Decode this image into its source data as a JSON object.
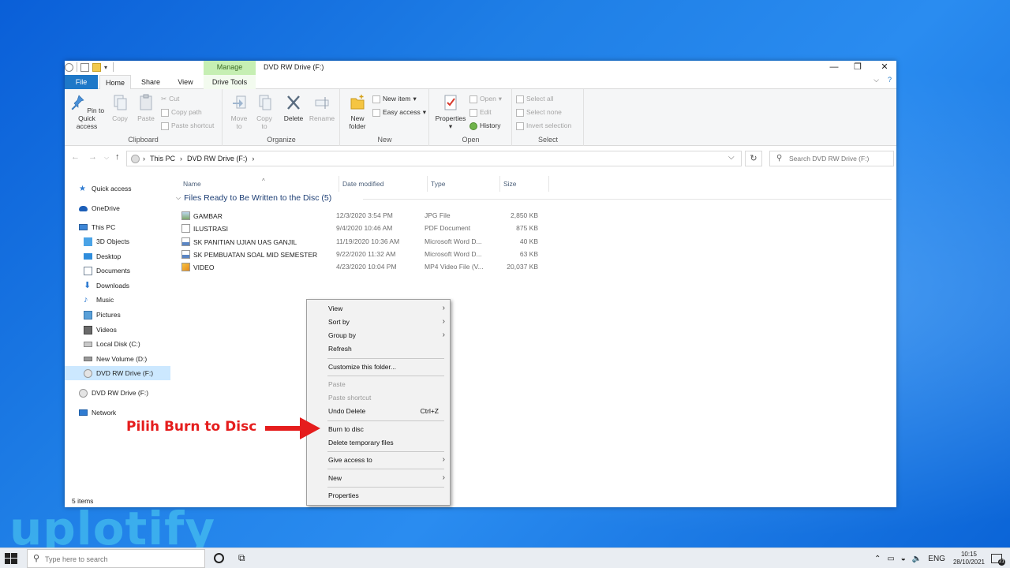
{
  "window": {
    "title": "DVD RW Drive (F:)",
    "contextual_tab_header": "Manage",
    "tabs": {
      "file": "File",
      "home": "Home",
      "share": "Share",
      "view": "View",
      "drive_tools": "Drive Tools"
    },
    "controls": {
      "minimize": "—",
      "maximize": "❐",
      "close": "✕"
    },
    "help": "?",
    "ribbon_toggle": "⌵"
  },
  "ribbon": {
    "clipboard": {
      "label": "Clipboard",
      "pin": "Pin to Quick access",
      "copy": "Copy",
      "paste": "Paste",
      "cut": "Cut",
      "copy_path": "Copy path",
      "paste_shortcut": "Paste shortcut"
    },
    "organize": {
      "label": "Organize",
      "move_to": "Move to",
      "copy_to": "Copy to",
      "delete": "Delete",
      "rename": "Rename"
    },
    "new": {
      "label": "New",
      "new_folder": "New folder",
      "new_item": "New item",
      "easy_access": "Easy access"
    },
    "open": {
      "label": "Open",
      "properties": "Properties",
      "open": "Open",
      "edit": "Edit",
      "history": "History"
    },
    "select": {
      "label": "Select",
      "select_all": "Select all",
      "select_none": "Select none",
      "invert": "Invert selection"
    }
  },
  "address": {
    "crumbs": [
      "This PC",
      "DVD RW Drive (F:)"
    ],
    "search_placeholder": "Search DVD RW Drive (F:)"
  },
  "navpane": {
    "items": [
      {
        "label": "Quick access",
        "icon": "star-icon",
        "color": "#2f7bd1"
      },
      {
        "label": "OneDrive",
        "icon": "cloud-icon",
        "color": "#1d5fb8"
      },
      {
        "label": "This PC",
        "icon": "computer-icon",
        "color": "#3d86d6"
      },
      {
        "label": "3D Objects",
        "icon": "cube-icon",
        "color": "#4aa3e6"
      },
      {
        "label": "Desktop",
        "icon": "desktop-icon",
        "color": "#2f8ddc"
      },
      {
        "label": "Documents",
        "icon": "documents-icon",
        "color": "#7a8a9c"
      },
      {
        "label": "Downloads",
        "icon": "download-icon",
        "color": "#2f7bd1"
      },
      {
        "label": "Music",
        "icon": "music-icon",
        "color": "#2f7bd1"
      },
      {
        "label": "Pictures",
        "icon": "pictures-icon",
        "color": "#5aa0d8"
      },
      {
        "label": "Videos",
        "icon": "videos-icon",
        "color": "#6a6a6a"
      },
      {
        "label": "Local Disk (C:)",
        "icon": "disk-icon",
        "color": "#8a8a8a"
      },
      {
        "label": "New Volume (D:)",
        "icon": "disk-icon",
        "color": "#6f6f6f"
      },
      {
        "label": "DVD RW Drive (F:)",
        "icon": "dvd-icon",
        "color": "#cfcfcf"
      },
      {
        "label": "DVD RW Drive (F:)",
        "icon": "dvd-icon",
        "color": "#cfcfcf"
      },
      {
        "label": "Network",
        "icon": "network-icon",
        "color": "#2f7bd1"
      }
    ]
  },
  "columns": {
    "name": "Name",
    "date": "Date modified",
    "type": "Type",
    "size": "Size"
  },
  "group_header": "Files Ready to Be Written to the Disc (5)",
  "files": [
    {
      "name": "GAMBAR",
      "date": "12/3/2020 3:54 PM",
      "type": "JPG File",
      "size": "2,850 KB",
      "icon": "image-file-icon"
    },
    {
      "name": "ILUSTRASI",
      "date": "9/4/2020 10:46 AM",
      "type": "PDF Document",
      "size": "875 KB",
      "icon": "pdf-file-icon"
    },
    {
      "name": "SK PANITIAN UJIAN UAS GANJIL",
      "date": "11/19/2020 10:36 AM",
      "type": "Microsoft Word D...",
      "size": "40 KB",
      "icon": "word-file-icon"
    },
    {
      "name": "SK PEMBUATAN SOAL MID SEMESTER",
      "date": "9/22/2020 11:32 AM",
      "type": "Microsoft Word D...",
      "size": "63 KB",
      "icon": "word-file-icon"
    },
    {
      "name": "VIDEO",
      "date": "4/23/2020 10:04 PM",
      "type": "MP4 Video File (V...",
      "size": "20,037 KB",
      "icon": "video-file-icon"
    }
  ],
  "status": {
    "items_count": "5 items"
  },
  "context_menu": {
    "view": "View",
    "sort_by": "Sort by",
    "group_by": "Group by",
    "refresh": "Refresh",
    "customize": "Customize this folder...",
    "paste": "Paste",
    "paste_shortcut": "Paste shortcut",
    "undo_delete": "Undo Delete",
    "undo_shortcut": "Ctrl+Z",
    "burn": "Burn to disc",
    "delete_temp": "Delete temporary files",
    "give_access": "Give access to",
    "new": "New",
    "properties": "Properties"
  },
  "annotation": {
    "text": "Pilih Burn to Disc",
    "color": "#e51d1d"
  },
  "watermark": "uplotify",
  "taskbar": {
    "search_placeholder": "Type here to search",
    "lang": "ENG",
    "time": "10:15",
    "date": "28/10/2021",
    "notification_count": "21"
  },
  "colors": {
    "accent": "#1e78c8",
    "manage_tab": "#c6efb3",
    "selection": "#cce8ff"
  }
}
